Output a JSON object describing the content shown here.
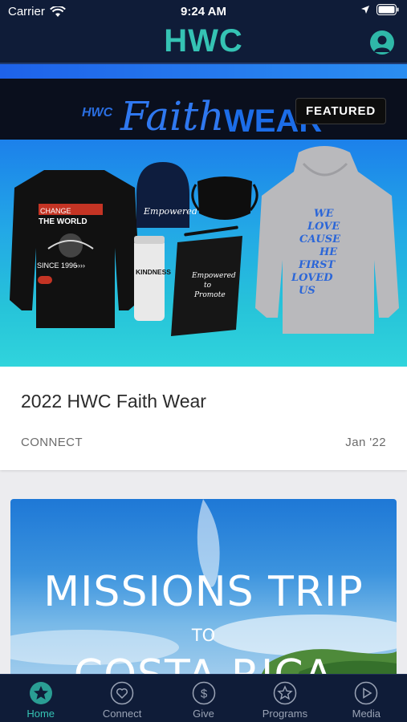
{
  "status_bar": {
    "carrier": "Carrier",
    "time": "9:24 AM"
  },
  "header": {
    "logo": "HWC"
  },
  "feed": {
    "featured": {
      "badge": "FEATURED",
      "banner": {
        "brand_prefix": "HWC",
        "brand_script": "Faith",
        "brand_bold": "WEAR"
      },
      "merch_text": {
        "sweater_line1": "CHANGE",
        "sweater_line2": "THE WORLD",
        "sweater_line3": "SINCE 1996",
        "beanie": "Empowered",
        "tumbler": "KINDNESS",
        "notebook_line1": "Empowered",
        "notebook_line2": "to",
        "notebook_line3": "Promote",
        "hoodie_line1": "WE",
        "hoodie_line2": "LOVE",
        "hoodie_line3": "CAUSE",
        "hoodie_line4": "HE",
        "hoodie_line5": "FIRST",
        "hoodie_line6": "LOVED",
        "hoodie_line7": "US"
      },
      "title": "2022 HWC Faith Wear",
      "category": "CONNECT",
      "date": "Jan '22"
    },
    "missions": {
      "title": "MISSIONS TRIP",
      "connector": "TO",
      "country": "COSTA RICA"
    }
  },
  "tabs": [
    {
      "label": "Home",
      "icon": "star-icon",
      "active": true
    },
    {
      "label": "Connect",
      "icon": "heart-icon",
      "active": false
    },
    {
      "label": "Give",
      "icon": "dollar-icon",
      "active": false
    },
    {
      "label": "Programs",
      "icon": "star-outline-icon",
      "active": false
    },
    {
      "label": "Media",
      "icon": "play-icon",
      "active": false
    }
  ],
  "colors": {
    "header_bg": "#0f1c38",
    "accent": "#35c3b4",
    "inactive": "#9aa3b5"
  }
}
